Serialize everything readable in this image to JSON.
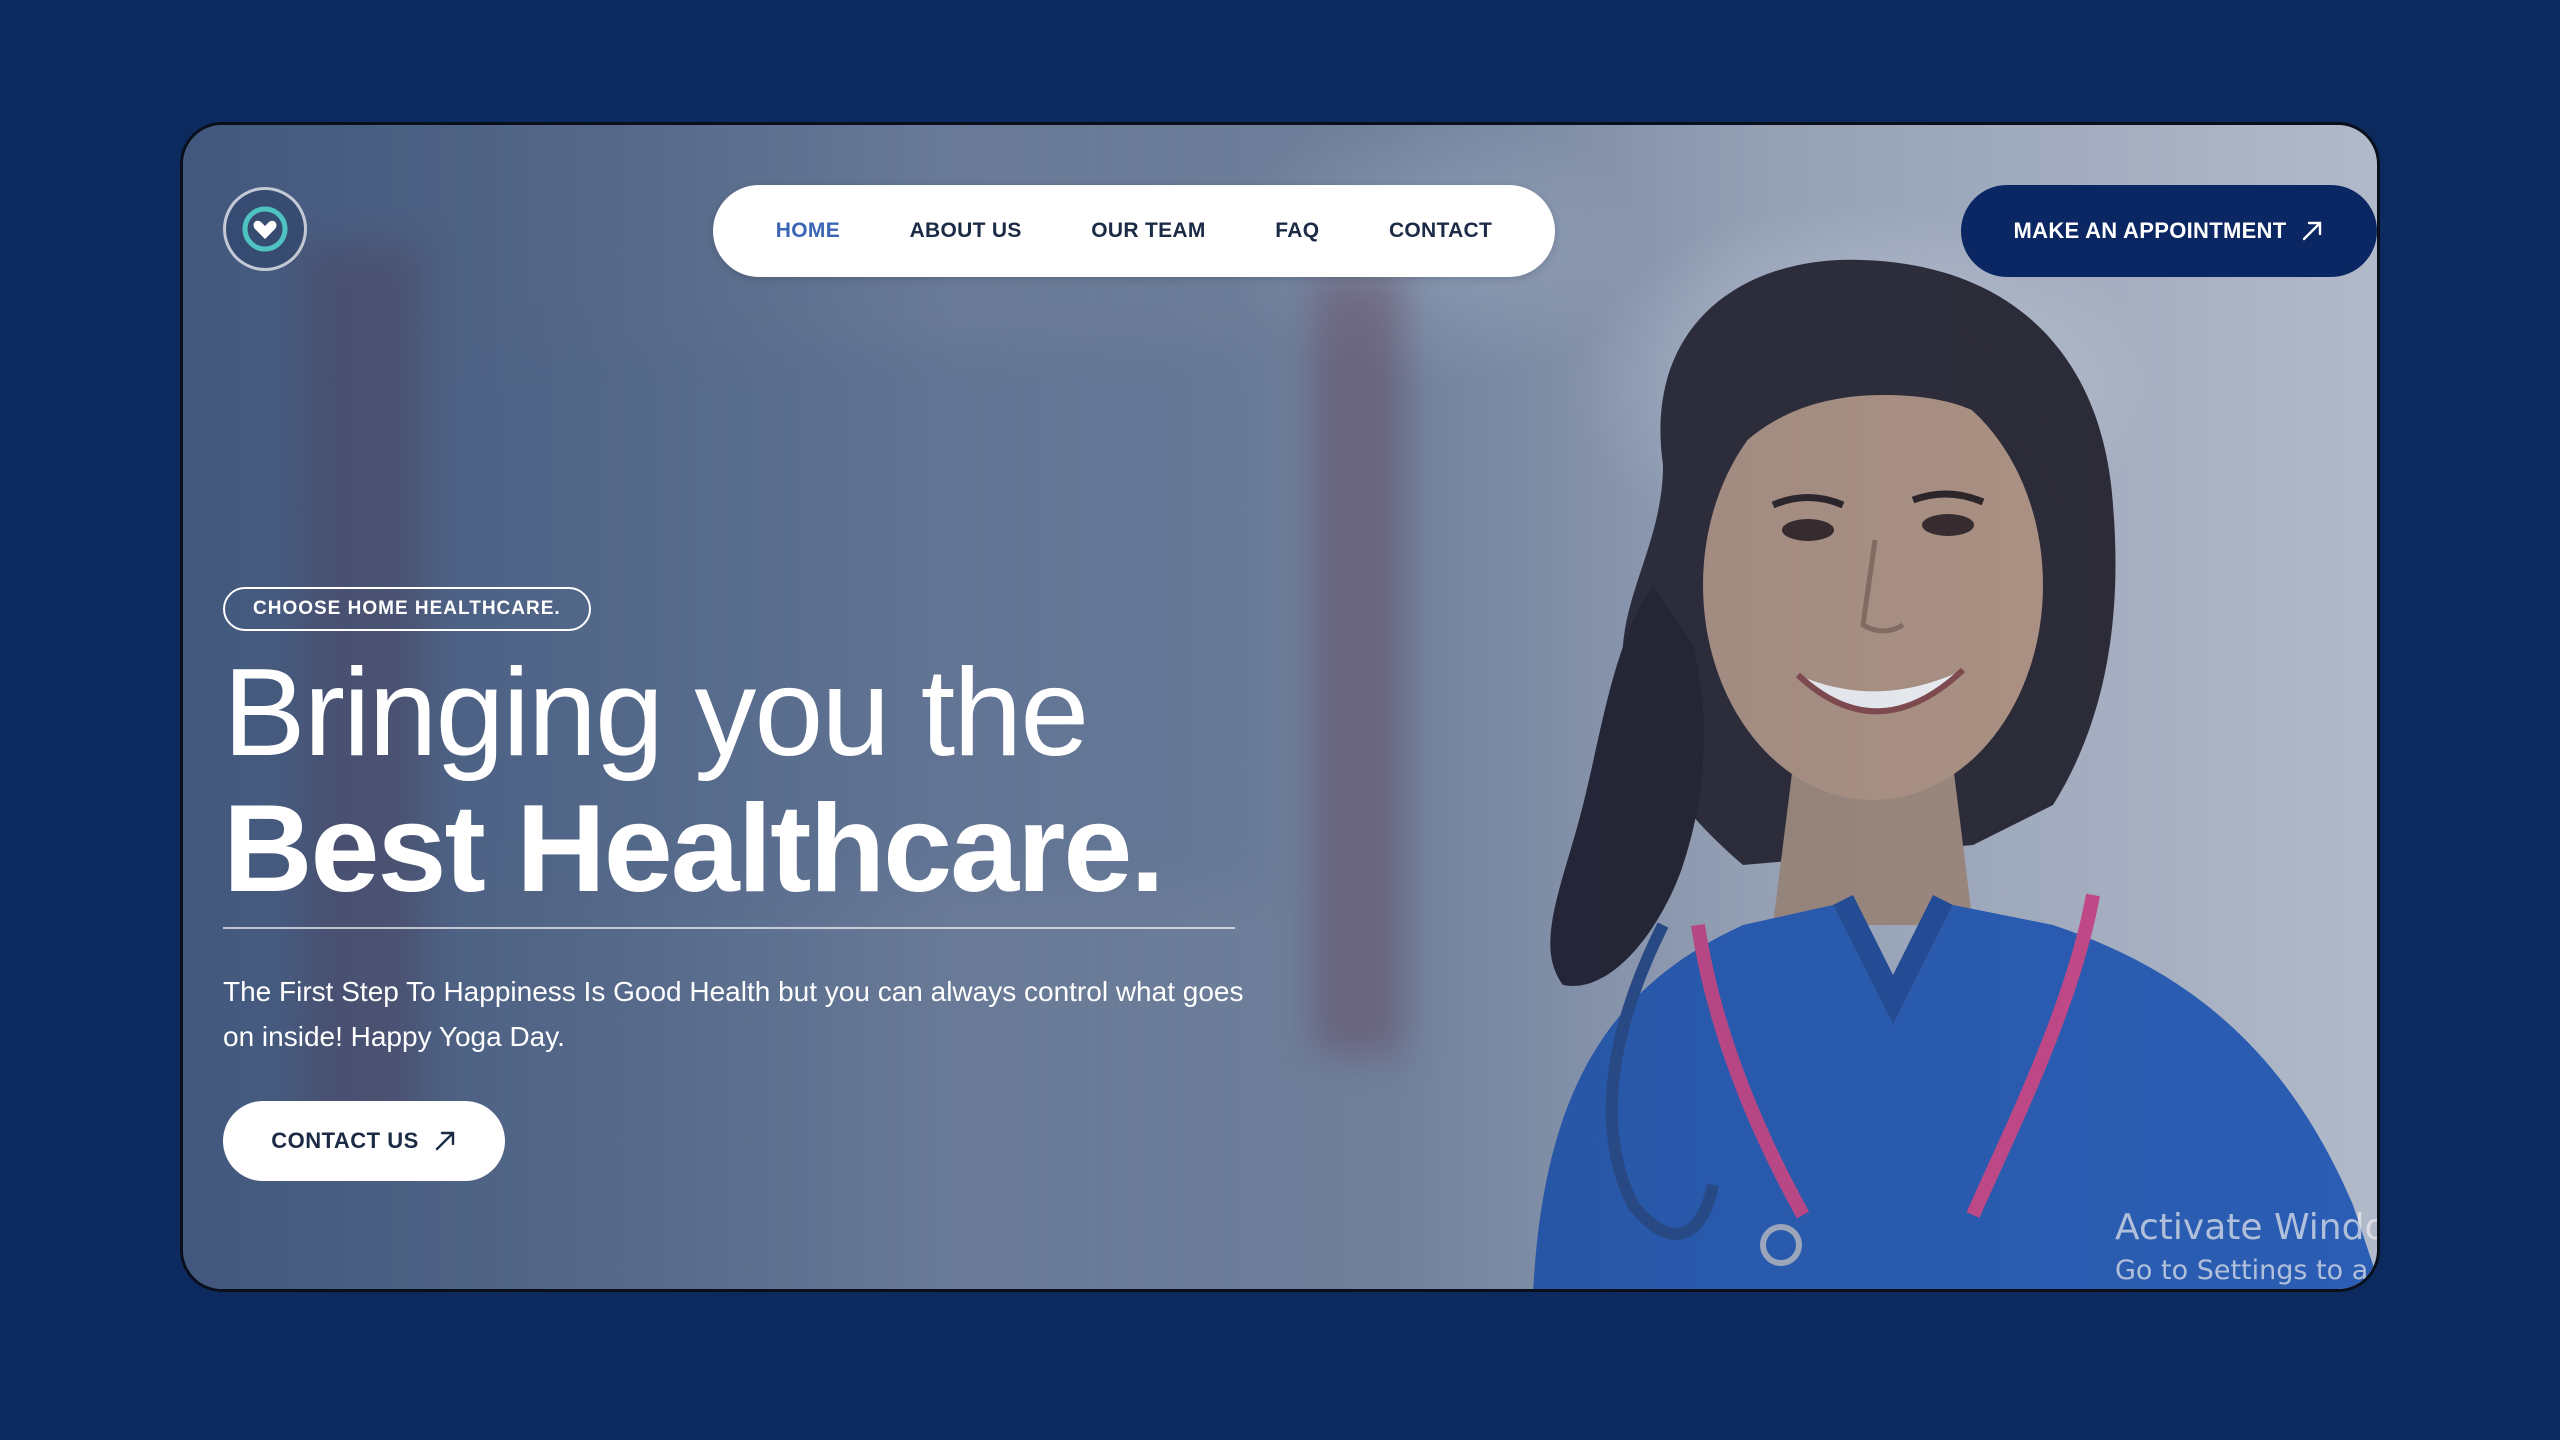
{
  "nav": {
    "items": [
      {
        "label": "HOME",
        "active": true
      },
      {
        "label": "ABOUT US",
        "active": false
      },
      {
        "label": "OUR TEAM",
        "active": false
      },
      {
        "label": "FAQ",
        "active": false
      },
      {
        "label": "CONTACT",
        "active": false
      }
    ],
    "cta_label": "MAKE AN APPOINTMENT",
    "cta_icon": "arrow-up-right-icon"
  },
  "hero": {
    "tag": "CHOOSE HOME HEALTHCARE.",
    "title_line1": "Bringing you the",
    "title_line2": "Best Healthcare.",
    "description": "The First Step To Happiness Is Good Health but you can always control what goes on inside! Happy Yoga Day.",
    "button_label": "CONTACT US",
    "button_icon": "arrow-up-right-icon",
    "image": "smiling-nurse-with-stethoscope"
  },
  "logo": {
    "icon": "heart-circle-logo-icon"
  },
  "watermark": {
    "line1": "Activate Windo",
    "line2": "Go to Settings to a"
  },
  "colors": {
    "page_background": "#0d2a5e",
    "primary": "#0b2763",
    "nav_active": "#3b66b5",
    "scrubs": "#2b5fb8",
    "lanyard": "#d04a8a"
  }
}
